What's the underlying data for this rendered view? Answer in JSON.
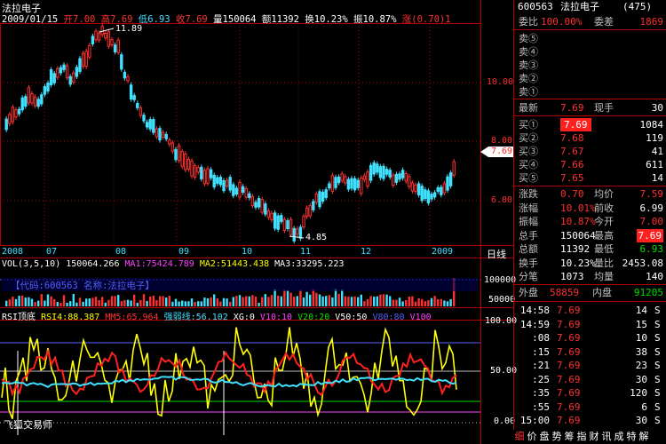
{
  "header": {
    "title": "法拉电子",
    "date": "2009/01/15",
    "open_label": "开",
    "open": "7.00",
    "high_label": "高",
    "high": "7.69",
    "low_label": "低",
    "low": "6.93",
    "close_label": "收",
    "close": "7.69",
    "vol_label": "量",
    "vol": "150064",
    "amount_label": "额",
    "amount": "11392",
    "turnover_label": "换",
    "turnover": "10.23%",
    "amplitude_label": "振",
    "amplitude": "10.87%",
    "change_label": "涨",
    "change": "(0.70)1"
  },
  "price_chart": {
    "high_marker": "11.89",
    "low_marker": "4.85",
    "axis_labels": [
      "10.00",
      "8.00",
      "6.00"
    ],
    "current_tag": "7.69",
    "x_labels": [
      "2008",
      "07",
      "08",
      "09",
      "10",
      "11",
      "12",
      "2009"
    ],
    "period_label": "日线"
  },
  "volume_panel": {
    "title": "VOL(3,5,10)",
    "value": "150064.266",
    "ma1_label": "MA1:",
    "ma1": "75424.789",
    "ma2_label": "MA2:",
    "ma2": "51443.438",
    "ma3_label": "MA3:",
    "ma3": "33295.223",
    "info": "【代码:600563 名称:法拉电子】",
    "axis_top": "100000",
    "axis_mid": "50000"
  },
  "rsi_panel": {
    "title": "RSI顶底",
    "rsi4_label": "RSI4:",
    "rsi4": "88.387",
    "mm5_label": "MM5:",
    "mm5": "65.964",
    "strong_label": "强弱线:",
    "strong": "56.102",
    "xg_label": "XG:",
    "xg": "0",
    "v10_label": "V10:",
    "v10": "10",
    "v20_label": "V20:",
    "v20": "20",
    "v50_label": "V50:",
    "v50": "50",
    "v80_label": "V80:",
    "v80": "80",
    "v100_label": "V100",
    "axis": [
      "100.00",
      "50.00",
      "0.00"
    ],
    "watermark": "飞狐交易师"
  },
  "quote": {
    "code": "600563",
    "name": "法拉电子",
    "count": "(475)",
    "weibi_label": "委比",
    "weibi": "100.00%",
    "weicha_label": "委差",
    "weicha": "1869",
    "sells": [
      {
        "label": "卖⑤",
        "price": "",
        "vol": ""
      },
      {
        "label": "卖④",
        "price": "",
        "vol": ""
      },
      {
        "label": "卖③",
        "price": "",
        "vol": ""
      },
      {
        "label": "卖②",
        "price": "",
        "vol": ""
      },
      {
        "label": "卖①",
        "price": "",
        "vol": ""
      }
    ],
    "latest_label": "最新",
    "latest": "7.69",
    "xianshou_label": "现手",
    "xianshou": "30",
    "buys": [
      {
        "label": "买①",
        "price": "7.69",
        "vol": "1084"
      },
      {
        "label": "买②",
        "price": "7.68",
        "vol": "119"
      },
      {
        "label": "买③",
        "price": "7.67",
        "vol": "41"
      },
      {
        "label": "买④",
        "price": "7.66",
        "vol": "611"
      },
      {
        "label": "买⑤",
        "price": "7.65",
        "vol": "14"
      }
    ],
    "stats": [
      {
        "l1": "涨跌",
        "v1": "0.70",
        "l2": "均价",
        "v2": "7.59"
      },
      {
        "l1": "涨幅",
        "v1": "10.01%",
        "l2": "前收",
        "v2": "6.99"
      },
      {
        "l1": "振幅",
        "v1": "10.87%",
        "l2": "今开",
        "v2": "7.00"
      },
      {
        "l1": "总手",
        "v1": "150064",
        "l2": "最高",
        "v2": "7.69"
      },
      {
        "l1": "总额",
        "v1": "11392",
        "l2": "最低",
        "v2": "6.93"
      },
      {
        "l1": "换手",
        "v1": "10.23%",
        "l2": "量比",
        "v2": "2453.08"
      },
      {
        "l1": "分笔",
        "v1": "1073",
        "l2": "均量",
        "v2": "140"
      }
    ],
    "outer_label": "外盘",
    "outer": "58859",
    "inner_label": "内盘",
    "inner": "91205",
    "ticks": [
      {
        "time": "14:58",
        "price": "7.69",
        "vol": "14",
        "flag": "S"
      },
      {
        "time": "14:59",
        "price": "7.69",
        "vol": "15",
        "flag": "S"
      },
      {
        "time": ":08",
        "price": "7.69",
        "vol": "10",
        "flag": "S"
      },
      {
        "time": ":15",
        "price": "7.69",
        "vol": "38",
        "flag": "S"
      },
      {
        "time": ":21",
        "price": "7.69",
        "vol": "23",
        "flag": "S"
      },
      {
        "time": ":25",
        "price": "7.69",
        "vol": "30",
        "flag": "S"
      },
      {
        "time": ":35",
        "price": "7.69",
        "vol": "120",
        "flag": "S"
      },
      {
        "time": ":55",
        "price": "7.69",
        "vol": "6",
        "flag": "S"
      },
      {
        "time": "15:00",
        "price": "7.69",
        "vol": "30",
        "flag": "S"
      }
    ],
    "tabs": [
      "细",
      "价",
      "盘",
      "势",
      "筹",
      "指",
      "财",
      "讯",
      "成",
      "特",
      "解"
    ]
  },
  "colors": {
    "up": "#ff3030",
    "down": "#40e0ff",
    "panel_border": "#b00000"
  }
}
